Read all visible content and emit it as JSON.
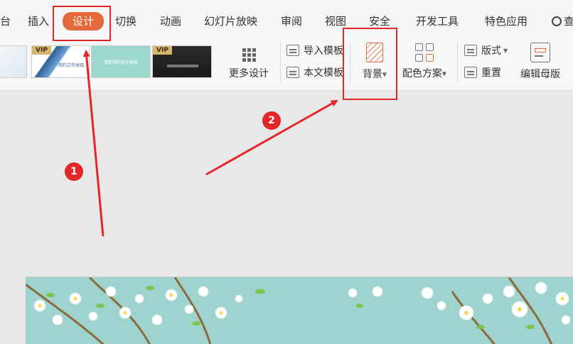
{
  "tabs": [
    {
      "id": "partial-left",
      "label": "台"
    },
    {
      "id": "insert",
      "label": "插入"
    },
    {
      "id": "design",
      "label": "设计",
      "active": true
    },
    {
      "id": "transition",
      "label": "切换"
    },
    {
      "id": "animation",
      "label": "动画"
    },
    {
      "id": "slideshow",
      "label": "幻灯片放映"
    },
    {
      "id": "review",
      "label": "审阅"
    },
    {
      "id": "view",
      "label": "视图"
    },
    {
      "id": "security",
      "label": "安全"
    },
    {
      "id": "developer",
      "label": "开发工具"
    },
    {
      "id": "special",
      "label": "特色应用"
    }
  ],
  "search": {
    "label": "查"
  },
  "templates": [
    {
      "vip": "",
      "caption": "",
      "variant": "blue-light"
    },
    {
      "vip": "VIP",
      "caption": "简约工作总结",
      "variant": "blue-diagonal"
    },
    {
      "vip": "",
      "caption": "清新简约设计报告",
      "variant": "mint"
    },
    {
      "vip": "VIP",
      "caption": "",
      "variant": "dark"
    }
  ],
  "ribbon": {
    "more_designs": "更多设计",
    "import_template": "导入模板",
    "this_template": "本文模板",
    "background": "背景",
    "color_scheme": "配色方案",
    "layout": "版式",
    "rearrange": "重置",
    "edit_master": "编辑母版"
  },
  "annotations": {
    "step1": "1",
    "step2": "2",
    "color": "#e3262a"
  },
  "colors": {
    "accent": "#e4693b",
    "slide_bg": "#9fd3d0"
  }
}
